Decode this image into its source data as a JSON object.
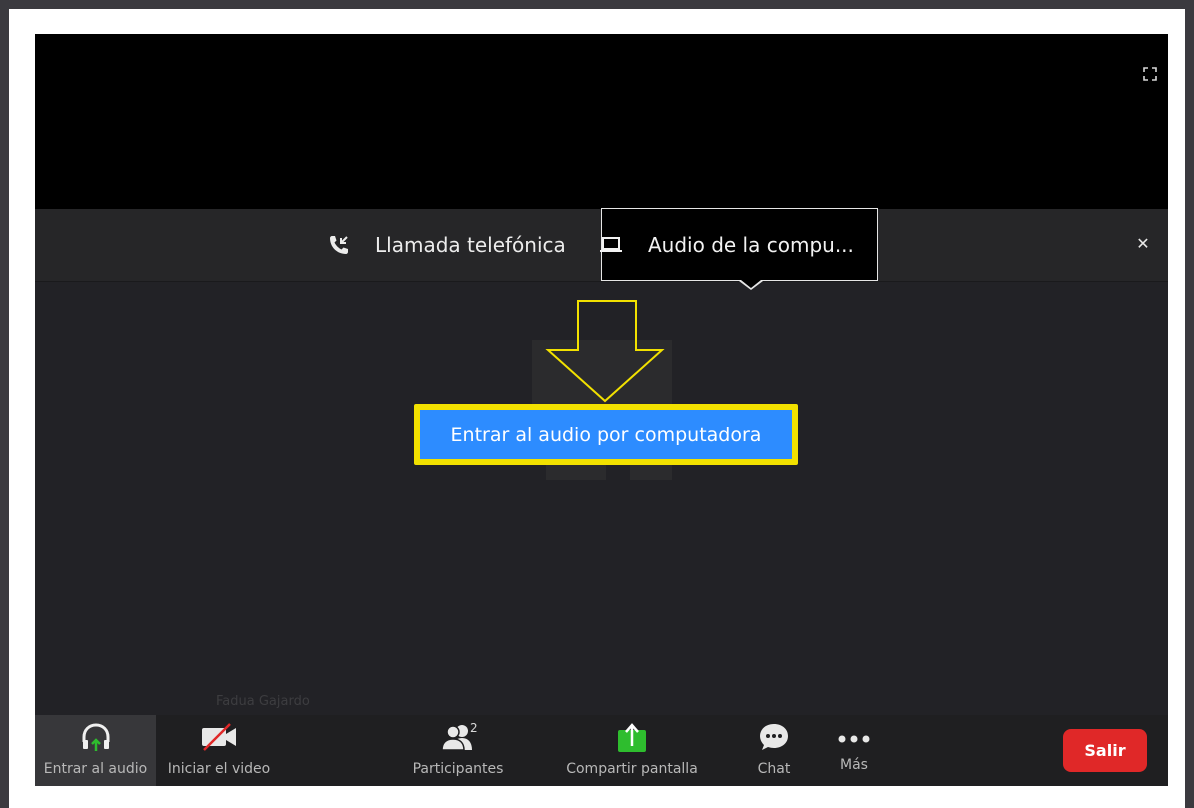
{
  "audio_tabs": {
    "phone_label": "Llamada telefónica",
    "computer_label": "Audio de la compu..."
  },
  "main": {
    "join_button_label": "Entrar al audio por computadora",
    "participant_name": "Fadua Gajardo"
  },
  "toolbar": {
    "join_audio_label": "Entrar al audio",
    "start_video_label": "Iniciar el video",
    "participants_label": "Participantes",
    "participants_count": "2",
    "share_screen_label": "Compartir pantalla",
    "chat_label": "Chat",
    "more_label": "Más",
    "leave_label": "Salir"
  },
  "colors": {
    "accent_blue": "#2d8cff",
    "highlight_yellow": "#f2e100",
    "leave_red": "#e02828",
    "share_green": "#2ebd2e"
  },
  "icons": [
    "fullscreen-icon",
    "phone-call-icon",
    "monitor-icon",
    "close-icon",
    "headphones-icon",
    "video-off-icon",
    "participants-icon",
    "share-screen-icon",
    "chat-icon",
    "more-icon",
    "arrow-down-icon"
  ]
}
